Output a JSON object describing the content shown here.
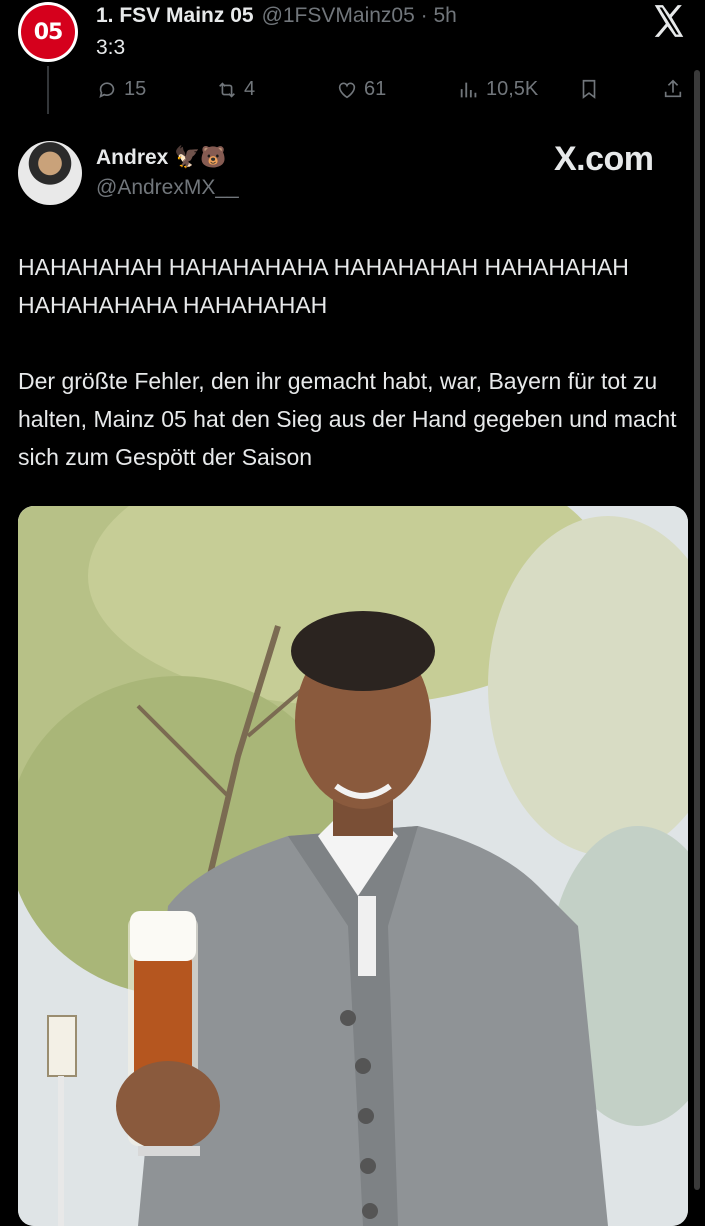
{
  "quoted_tweet": {
    "avatar_text": "05",
    "name": "1. FSV Mainz 05",
    "handle_time": "@1FSVMainz05 · 5h",
    "text": "3:3",
    "metrics": {
      "replies": "15",
      "retweets": "4",
      "likes": "61",
      "views": "10,5K"
    }
  },
  "tweet": {
    "name": "Andrex 🦅🐻",
    "handle": "@AndrexMX__",
    "watermark": "X.com",
    "paragraph1": "HAHAHAHAH HAHAHAHAHA HAHAHAHAH HAHAHAHAH HAHAHAHAHA HAHAHAHAH",
    "paragraph2": "Der größte Fehler, den ihr gemacht habt, war, Bayern für tot zu halten, Mainz 05 hat den Sieg aus der Hand gegeben und macht sich zum Gespött der Saison"
  },
  "icons": [
    "reply-icon",
    "retweet-icon",
    "like-icon",
    "views-icon",
    "bookmark-icon",
    "share-icon",
    "x-logo-icon"
  ]
}
